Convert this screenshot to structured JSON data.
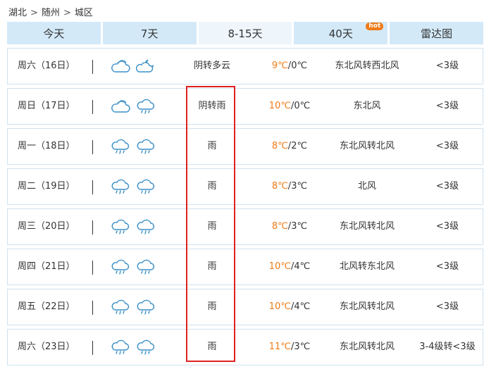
{
  "breadcrumb": {
    "items": [
      "湖北",
      "随州",
      "城区"
    ],
    "separator": ">"
  },
  "tabs": [
    {
      "label": "今天",
      "active": false
    },
    {
      "label": "7天",
      "active": false
    },
    {
      "label": "8-15天",
      "active": true
    },
    {
      "label": "40天",
      "active": false,
      "badge": "hot"
    },
    {
      "label": "雷达图",
      "active": false
    }
  ],
  "colors": {
    "tab_bg": "#d3e9f8",
    "tab_active_bg": "#eef6fc",
    "high_temp": "#f07b16",
    "icon_stroke": "#3a8fc7",
    "highlight_border": "#e02020",
    "hot_badge": "#f07b16"
  },
  "forecast": [
    {
      "date": "周六（16日）",
      "icons": [
        "cloudy-icon",
        "partly-cloudy-night-icon"
      ],
      "desc": "阴转多云",
      "high": "9℃",
      "low": "0℃",
      "wind": "东北风转西北风",
      "level": "<3级"
    },
    {
      "date": "周日（17日）",
      "icons": [
        "cloudy-icon",
        "rain-icon"
      ],
      "desc": "阴转雨",
      "high": "10℃",
      "low": "0℃",
      "wind": "东北风",
      "level": "<3级"
    },
    {
      "date": "周一（18日）",
      "icons": [
        "rain-icon",
        "rain-icon"
      ],
      "desc": "雨",
      "high": "8℃",
      "low": "2℃",
      "wind": "东北风转北风",
      "level": "<3级"
    },
    {
      "date": "周二（19日）",
      "icons": [
        "rain-icon",
        "rain-icon"
      ],
      "desc": "雨",
      "high": "8℃",
      "low": "3℃",
      "wind": "北风",
      "level": "<3级"
    },
    {
      "date": "周三（20日）",
      "icons": [
        "rain-icon",
        "rain-icon"
      ],
      "desc": "雨",
      "high": "8℃",
      "low": "3℃",
      "wind": "东北风转北风",
      "level": "<3级"
    },
    {
      "date": "周四（21日）",
      "icons": [
        "rain-icon",
        "rain-icon"
      ],
      "desc": "雨",
      "high": "10℃",
      "low": "4℃",
      "wind": "北风转东北风",
      "level": "<3级"
    },
    {
      "date": "周五（22日）",
      "icons": [
        "rain-icon",
        "rain-icon"
      ],
      "desc": "雨",
      "high": "10℃",
      "low": "4℃",
      "wind": "东北风转北风",
      "level": "<3级"
    },
    {
      "date": "周六（23日）",
      "icons": [
        "rain-icon",
        "rain-icon"
      ],
      "desc": "雨",
      "high": "11℃",
      "low": "3℃",
      "wind": "东北风转北风",
      "level": "3-4级转<3级"
    }
  ]
}
